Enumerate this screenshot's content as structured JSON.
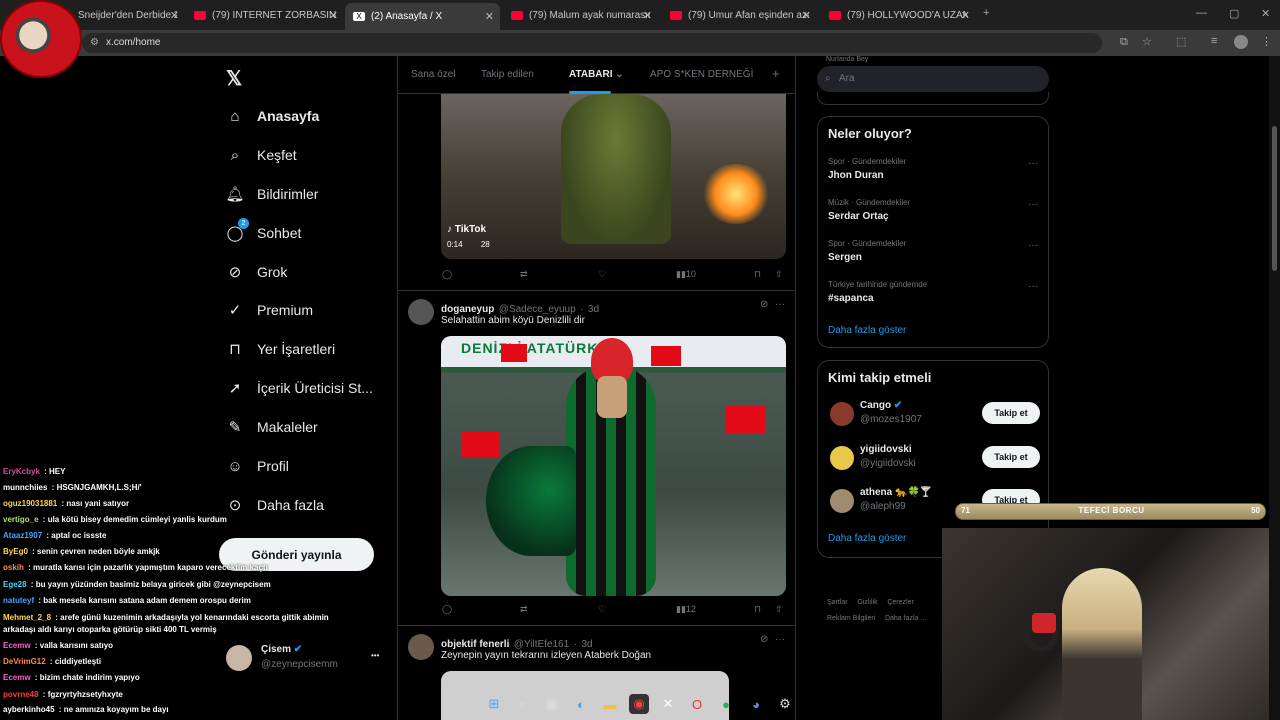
{
  "browser": {
    "tabs": [
      {
        "label": "Sneijder'den Derbide 2",
        "icon": "youtube-icon"
      },
      {
        "label": "(79) İNTERNET ZORBASINA SOL",
        "icon": "youtube-icon"
      },
      {
        "label": "(2) Anasayfa / X",
        "icon": "x-icon",
        "active": true
      },
      {
        "label": "(79) Malum ayak numarasına kı",
        "icon": "youtube-icon"
      },
      {
        "label": "(79) Umur Afan eşinden azar yi",
        "icon": "youtube-icon"
      },
      {
        "label": "(79) HOLLYWOOD'A UZANAN Y",
        "icon": "youtube-icon"
      }
    ],
    "url": "x.com/home",
    "new_tab": "+"
  },
  "sidebar": {
    "items": [
      {
        "label": "Anasayfa",
        "icon": "home-icon"
      },
      {
        "label": "Keşfet",
        "icon": "search-icon"
      },
      {
        "label": "Bildirimler",
        "icon": "bell-icon"
      },
      {
        "label": "Sohbet",
        "icon": "chat-icon",
        "badge": "2"
      },
      {
        "label": "Grok",
        "icon": "grok-icon"
      },
      {
        "label": "Premium",
        "icon": "premium-icon"
      },
      {
        "label": "Yer İşaretleri",
        "icon": "bookmark-icon"
      },
      {
        "label": "İçerik Üreticisi St...",
        "icon": "rocket-icon"
      },
      {
        "label": "Makaleler",
        "icon": "article-icon"
      },
      {
        "label": "Profil",
        "icon": "profile-icon"
      },
      {
        "label": "Daha fazla",
        "icon": "more-icon"
      }
    ],
    "post_button": "Gönderi yayınla",
    "account": {
      "name": "Çisem",
      "handle": "@zeynepcisemm",
      "more": "•••"
    }
  },
  "feed": {
    "tabs": [
      "Sana özel",
      "Takip edilen",
      "ATABARI",
      "APO S*KEN DERNEĞİ"
    ],
    "active_tab": "ATABARI",
    "add_tab": "+",
    "post1": {
      "video_source": "TikTok",
      "video_time": "0:14",
      "video_user": "28",
      "views": "10"
    },
    "post2": {
      "name": "doganeyup",
      "handle": "@Sadece_eyuup",
      "age": "3d",
      "text": "Selahattin abim köyü Denizlili dir",
      "views": "12",
      "banner": "DENİZLİ ATATÜRK"
    },
    "post3": {
      "name": "objektif fenerli",
      "handle": "@YiltEfe161",
      "age": "3d",
      "text": "Zeynepin yayın tekrarını izleyen Ataberk Doğan"
    }
  },
  "right": {
    "search_placeholder": "Ara",
    "partial_name": "Nurlanda Bey",
    "trends_title": "Neler oluyor?",
    "trends": [
      {
        "meta": "Spor · Gündemdekiler",
        "name": "Jhon Duran"
      },
      {
        "meta": "Müzik · Gündemdekiler",
        "name": "Serdar Ortaç"
      },
      {
        "meta": "Spor · Gündemdekiler",
        "name": "Sergen"
      },
      {
        "meta": "Türkiye tarihinde gündemde",
        "name": "#sapanca"
      }
    ],
    "show_more": "Daha fazla göster",
    "who_title": "Kimi takip etmeli",
    "who": [
      {
        "name": "Cango",
        "handle": "@mozes1907",
        "verified": true
      },
      {
        "name": "yigiidovski",
        "handle": "@yigiidovski",
        "verified": false
      },
      {
        "name": "athena 🐆🍀🍸",
        "handle": "@aleph99",
        "verified": false
      }
    ],
    "follow_label": "Takip et",
    "who_show_more": "Daha fazla göster",
    "footer_row1": [
      "Şartlar",
      "Gizlilik",
      "Çerezler"
    ],
    "footer_row2": [
      "Reklam Bilgileri",
      "Daha fazla ..."
    ]
  },
  "stream_overlay": {
    "progress": {
      "left": "71",
      "title": "TEFECİ BORCU",
      "right": "50",
      "fraction": 0.0
    },
    "chat": [
      {
        "user": "EryKcbyk",
        "msg": "HEY",
        "color": "#d14f9f"
      },
      {
        "user": "munnchiies",
        "msg": "HSGNJGAMKH,L.S;H/'",
        "color": "#ffffff"
      },
      {
        "user": "oguz19031881",
        "msg": "nası yani satıyor",
        "color": "#ffd84a"
      },
      {
        "user": "vertigo_e",
        "msg": "ula kötü bisey demedim cümleyi yanlis kurdum",
        "color": "#a8e36b"
      },
      {
        "user": "Ataaz1907",
        "msg": "aptal oc issste",
        "color": "#46a4ff"
      },
      {
        "user": "ByEg0",
        "msg": "senin çevren neden böyle amkjk",
        "color": "#ffd84a"
      },
      {
        "user": "oskih",
        "msg": "muratla karısı için pazarlık yapmıştım kaparo verecektim kaçtı",
        "color": "#ff8a3d"
      },
      {
        "user": "Ege28",
        "msg": "bu yayın yüzünden basimiz belaya giricek gibi @zeynepcisem",
        "color": "#46d4ff"
      },
      {
        "user": "natuteyf",
        "msg": "bak mesela karısını satana adam demem orospu derim",
        "color": "#46a4ff"
      },
      {
        "user": "Mehmet_2_8",
        "msg": "arefe günü kuzenimin arkadaşıyla yol kenarındaki escorta gittik abimin arkadaşı aldı karıyı otoparka götürüp sikti 400 TL vermiş",
        "color": "#ffd84a"
      },
      {
        "user": "Ecemw",
        "msg": "valla karısını satıyo",
        "color": "#ff5ad9"
      },
      {
        "user": "DeVrimG12",
        "msg": "ciddiyetleşti",
        "color": "#ff8a3d"
      },
      {
        "user": "Ecemw",
        "msg": "bizim chate indirim yapıyo",
        "color": "#ff5ad9"
      },
      {
        "user": "povrne48",
        "msg": "fgzryrtyhzsetyhxyte",
        "color": "#ff3b3b"
      },
      {
        "user": "ayberkinho45",
        "msg": "ne amınıza koyayım be dayı",
        "color": "#ffffff"
      }
    ]
  }
}
